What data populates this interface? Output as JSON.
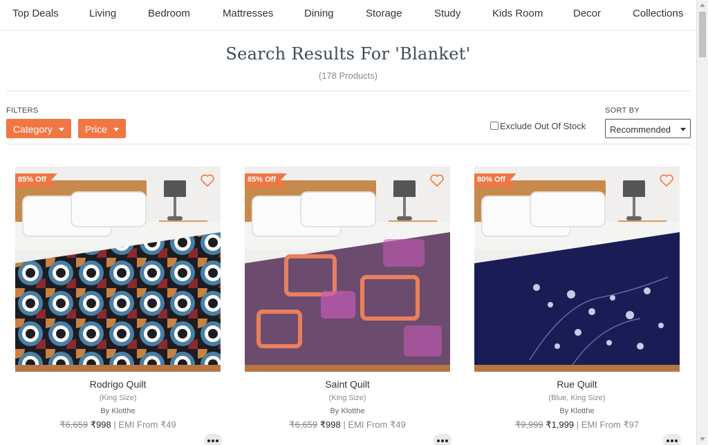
{
  "nav": {
    "items": [
      "Top Deals",
      "Living",
      "Bedroom",
      "Mattresses",
      "Dining",
      "Storage",
      "Study",
      "Kids Room",
      "Decor",
      "Collections"
    ]
  },
  "header": {
    "title": "Search Results For 'Blanket'",
    "count": "(178 Products)"
  },
  "filters": {
    "label": "FILTERS",
    "category": "Category",
    "price": "Price",
    "exclude_out_of_stock": "Exclude Out Of Stock",
    "exclude_checked": false
  },
  "sort": {
    "label": "SORT BY",
    "selected": "Recommended"
  },
  "products": [
    {
      "badge": "85% Off",
      "name": "Rodrigo Quilt",
      "variant": "(King Size)",
      "brand": "By Klotthe",
      "mrp": "₹6,659",
      "price": "₹998",
      "emi": "| EMI From ₹49",
      "quilt_colors": [
        "#1c1c22",
        "#4a7fa3",
        "#c9813f",
        "#8a2a2c",
        "#ffffff"
      ]
    },
    {
      "badge": "85% Off",
      "name": "Saint Quilt",
      "variant": "(King Size)",
      "brand": "By Klotthe",
      "mrp": "₹6,659",
      "price": "₹998",
      "emi": "| EMI From ₹49",
      "quilt_colors": [
        "#6c4c6e",
        "#e8805c",
        "#c45ab4",
        "#5e4565"
      ]
    },
    {
      "badge": "80% Off",
      "name": "Rue Quilt",
      "variant": "(Blue, King Size)",
      "brand": "By Klotthe",
      "mrp": "₹9,999",
      "price": "₹1,999",
      "emi": "| EMI From ₹97",
      "quilt_colors": [
        "#1a1d55",
        "#c8cbe6",
        "#5f6aa8"
      ]
    }
  ],
  "colors": {
    "accent": "#f07743",
    "heading": "#3d4a55"
  }
}
